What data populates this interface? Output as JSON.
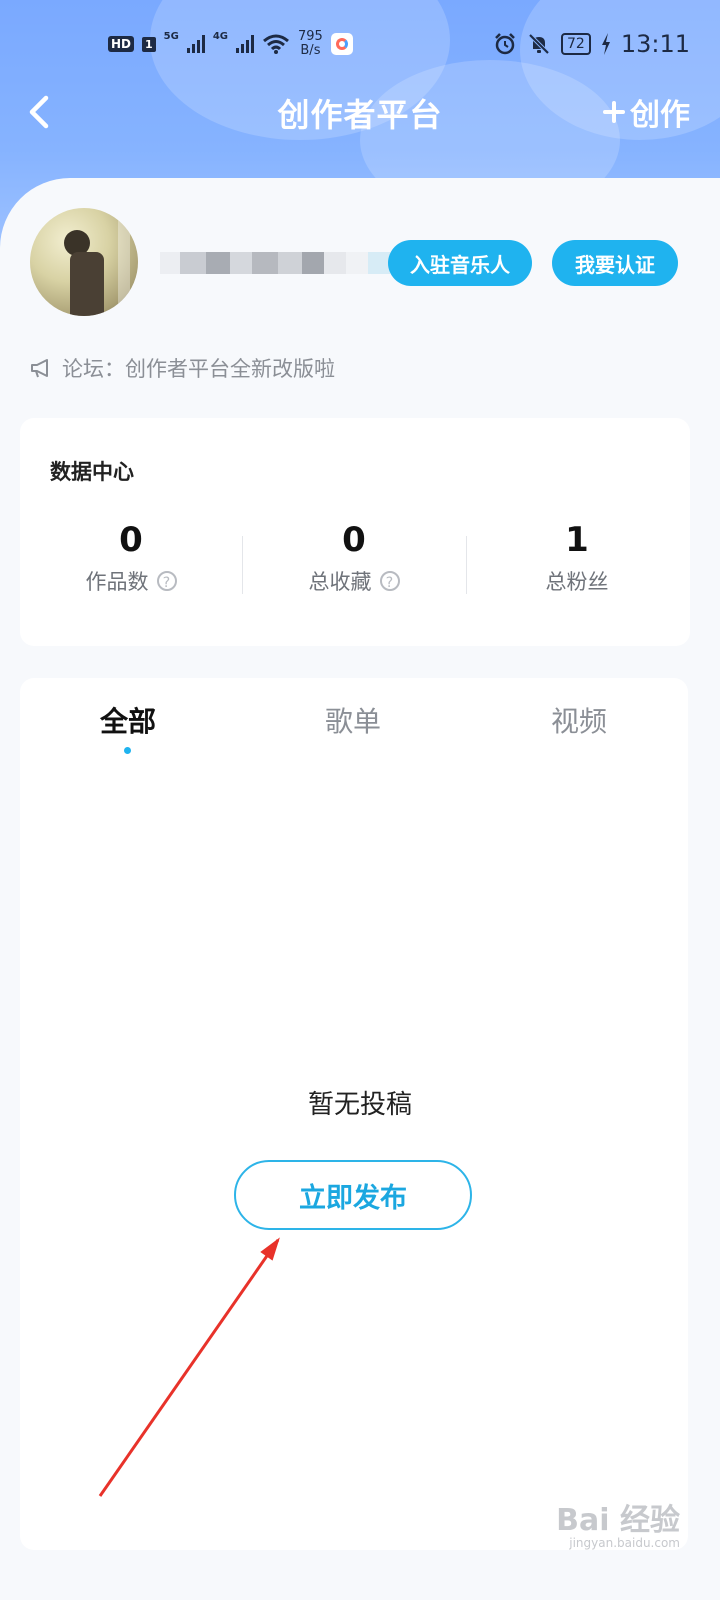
{
  "status_bar": {
    "hd_label": "HD",
    "sim_label": "1",
    "net1_label": "5G",
    "net2_label": "4G",
    "speed_value": "795",
    "speed_unit": "B/s",
    "battery": "72",
    "time": "13:11",
    "icons": [
      "wifi-icon",
      "alarm-icon",
      "mute-bell-icon",
      "charging-icon"
    ]
  },
  "navbar": {
    "title": "创作者平台",
    "create_label": "创作",
    "icons": [
      "back-chevron-icon",
      "plus-icon"
    ]
  },
  "profile": {
    "join_musician_label": "入驻音乐人",
    "verify_label": "我要认证"
  },
  "forum": {
    "text": "论坛：创作者平台全新改版啦",
    "icon": "megaphone-icon"
  },
  "data_center": {
    "title": "数据中心",
    "stats": [
      {
        "value": "0",
        "label": "作品数",
        "help": "?"
      },
      {
        "value": "0",
        "label": "总收藏",
        "help": "?"
      },
      {
        "value": "1",
        "label": "总粉丝"
      }
    ]
  },
  "tabs": {
    "items": [
      {
        "label": "全部",
        "active": true
      },
      {
        "label": "歌单",
        "active": false
      },
      {
        "label": "视频",
        "active": false
      }
    ]
  },
  "empty_state": {
    "message": "暂无投稿",
    "publish_label": "立即发布"
  },
  "watermark": {
    "text": "Bai 经验",
    "url_text": "jingyan.baidu.com"
  },
  "colors": {
    "header_blue": "#86b3ff",
    "accent_cyan": "#1fb3ef",
    "arrow_red": "#e8322a"
  }
}
